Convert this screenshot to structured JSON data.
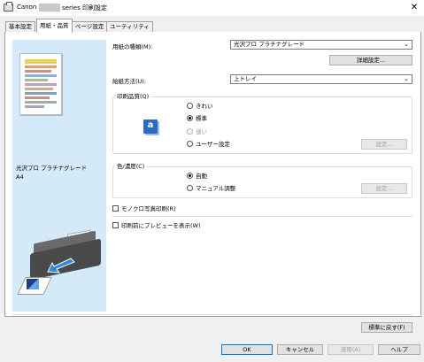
{
  "window": {
    "title_prefix": "Canon",
    "title_suffix": "series 印刷設定",
    "close_glyph": "✕"
  },
  "tabs": [
    {
      "label": "基本設定"
    },
    {
      "label": "用紙・品質"
    },
    {
      "label": "ページ設定"
    },
    {
      "label": "ユーティリティ"
    }
  ],
  "preview": {
    "media_name": "光沢プロ プラチナグレード",
    "paper_size": "A4"
  },
  "media_type": {
    "label": "用紙の種類(M):",
    "value": "光沢プロ プラチナグレード",
    "details_button": "詳細設定..."
  },
  "paper_source": {
    "label": "給紙方法(U):",
    "value": "上トレイ"
  },
  "print_quality": {
    "group_label": "印刷品質(Q)",
    "icon_glyph": "a",
    "options": [
      {
        "label": "きれい",
        "selected": false,
        "disabled": false
      },
      {
        "label": "標準",
        "selected": true,
        "disabled": false
      },
      {
        "label": "速い",
        "selected": false,
        "disabled": true
      },
      {
        "label": "ユーザー設定",
        "selected": false,
        "disabled": false
      }
    ],
    "settings_button": "設定..."
  },
  "color_intensity": {
    "group_label": "色/濃度(C)",
    "options": [
      {
        "label": "自動",
        "selected": true
      },
      {
        "label": "マニュアル調整",
        "selected": false
      }
    ],
    "settings_button": "設定..."
  },
  "grayscale": {
    "label": "モノクロ写真印刷(R)",
    "checked": false
  },
  "preview_before_print": {
    "label": "印刷前にプレビューを表示(W)",
    "checked": false
  },
  "defaults_button": "標準に戻す(F)",
  "footer": {
    "ok": "OK",
    "cancel": "キャンセル",
    "apply": "適用(A)",
    "help": "ヘルプ"
  },
  "colors": {
    "preview_background": "#d4eaf8",
    "default_button_border": "#0078d7"
  }
}
